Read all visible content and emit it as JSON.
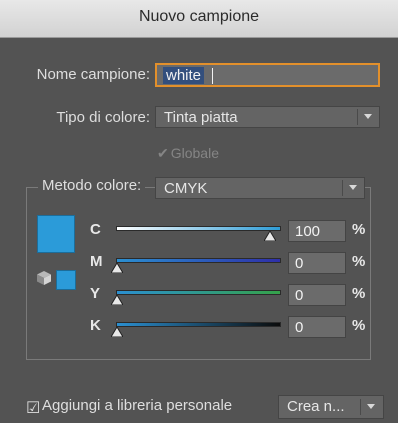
{
  "dialog": {
    "title": "Nuovo campione",
    "name": {
      "label": "Nome campione:",
      "value": "white"
    },
    "color_type": {
      "label": "Tipo di colore:",
      "value": "Tinta piatta"
    },
    "global": {
      "label": "Globale",
      "checked": true,
      "disabled": true
    },
    "color_mode": {
      "label": "Metodo colore:",
      "value": "CMYK"
    },
    "swatch_color": "#2b9bd9",
    "channels": [
      {
        "key": "C",
        "value": "100",
        "unit": "%",
        "fraction": 1.0
      },
      {
        "key": "M",
        "value": "0",
        "unit": "%",
        "fraction": 0.0
      },
      {
        "key": "Y",
        "value": "0",
        "unit": "%",
        "fraction": 0.0
      },
      {
        "key": "K",
        "value": "0",
        "unit": "%",
        "fraction": 0.0
      }
    ],
    "add_to_library": {
      "label": "Aggiungi a libreria personale",
      "checked": true
    },
    "create_button": {
      "label": "Crea n..."
    }
  }
}
